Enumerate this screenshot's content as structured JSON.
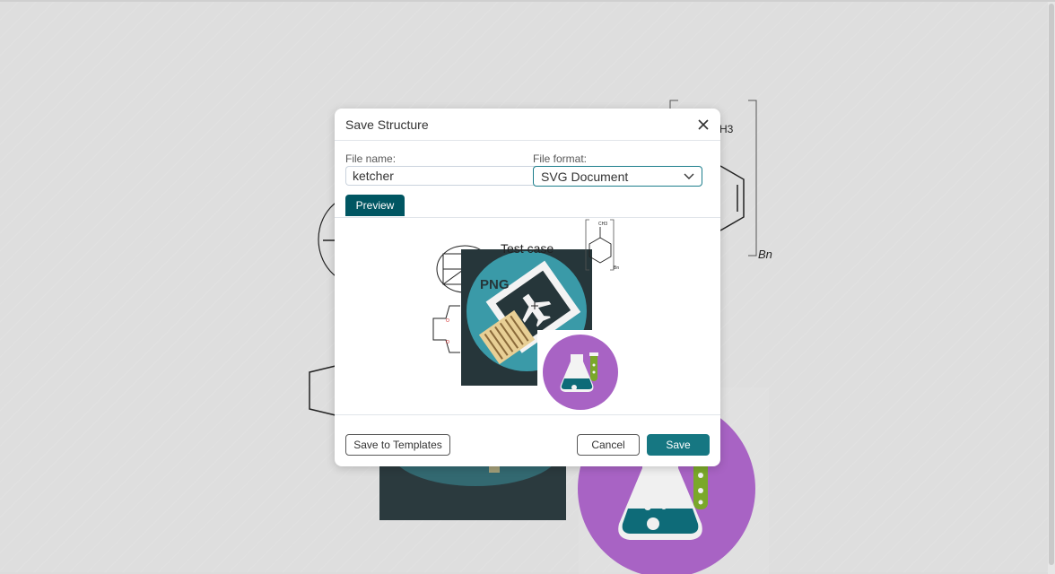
{
  "background": {
    "structure_labels": [
      "CH3",
      "Bn"
    ]
  },
  "dialog": {
    "title": "Save Structure",
    "filename_label": "File name:",
    "filename_value": "ketcher",
    "format_label": "File format:",
    "format_value": "SVG Document",
    "tab_preview": "Preview",
    "preview": {
      "test_case_text": "Test case",
      "png_label": "PNG",
      "ch3_label": "CH3",
      "bn_label": "Bn"
    },
    "save_templates_label": "Save to Templates",
    "cancel_label": "Cancel",
    "save_label": "Save"
  },
  "colors": {
    "primary": "#167782",
    "tab_active": "#005662",
    "flask_purple": "#a863c4",
    "stamp_teal": "#3a9aa8",
    "dark_tile": "#26363a"
  },
  "icons": [
    "close-icon",
    "chevron-down-icon",
    "airplane-stamp-icon",
    "flask-icon"
  ]
}
